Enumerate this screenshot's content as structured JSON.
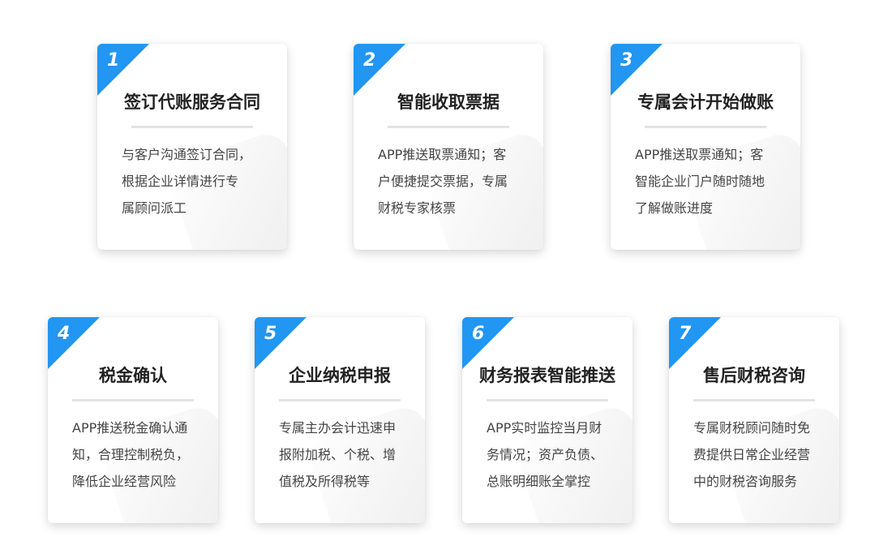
{
  "accent_color": "#2196f3",
  "steps": [
    {
      "number": "1",
      "title": "签订代账服务合同",
      "lines": [
        "与客户沟通签订合同，",
        "根据企业详情进行专",
        "属顾问派工"
      ]
    },
    {
      "number": "2",
      "title": "智能收取票据",
      "lines": [
        "APP推送取票通知；客",
        "户便捷提交票据，专属",
        "财税专家核票"
      ]
    },
    {
      "number": "3",
      "title": "专属会计开始做账",
      "lines": [
        "APP推送取票通知；客",
        "智能企业门户随时随地",
        "了解做账进度"
      ]
    },
    {
      "number": "4",
      "title": "税金确认",
      "lines": [
        "APP推送税金确认通",
        "知，合理控制税负，",
        "降低企业经营风险"
      ]
    },
    {
      "number": "5",
      "title": "企业纳税申报",
      "lines": [
        "专属主办会计迅速申",
        "报附加税、个税、增",
        "值税及所得税等"
      ]
    },
    {
      "number": "6",
      "title": "财务报表智能推送",
      "lines": [
        "APP实时监控当月财",
        "务情况；资产负债、",
        "总账明细账全掌控"
      ]
    },
    {
      "number": "7",
      "title": "售后财税咨询",
      "lines": [
        "专属财税顾问随时免",
        "费提供日常企业经营",
        "中的财税咨询服务"
      ]
    }
  ]
}
